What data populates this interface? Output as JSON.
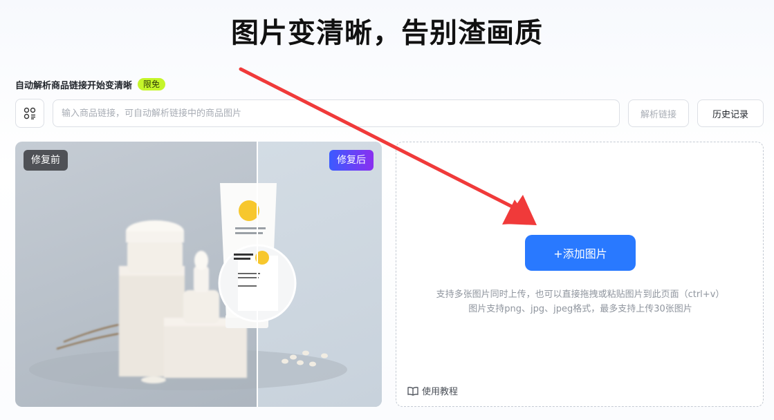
{
  "header": {
    "title": "图片变清晰，告别渣画质"
  },
  "link_section": {
    "subtitle": "自动解析商品链接开始变清晰",
    "badge": "限免",
    "input_placeholder": "输入商品链接，可自动解析链接中的商品图片",
    "input_value": "",
    "parse_button": "解析链接",
    "history_button": "历史记录"
  },
  "demo": {
    "before_label": "修复前",
    "after_label": "修复后"
  },
  "upload": {
    "add_button": "+添加图片",
    "hint_line1": "支持多张图片同时上传，也可以直接拖拽或粘贴图片到此页面（ctrl+v）",
    "hint_line2": "图片支持png、jpg、jpeg格式，最多支持上传30张图片",
    "tutorial_link": "使用教程"
  },
  "icons": [
    "scan-icon",
    "book-icon",
    "arrow-annotation"
  ],
  "colors": {
    "primary": "#2979ff",
    "badge_bg": "#c5f52a",
    "arrow": "#f03a3a"
  }
}
